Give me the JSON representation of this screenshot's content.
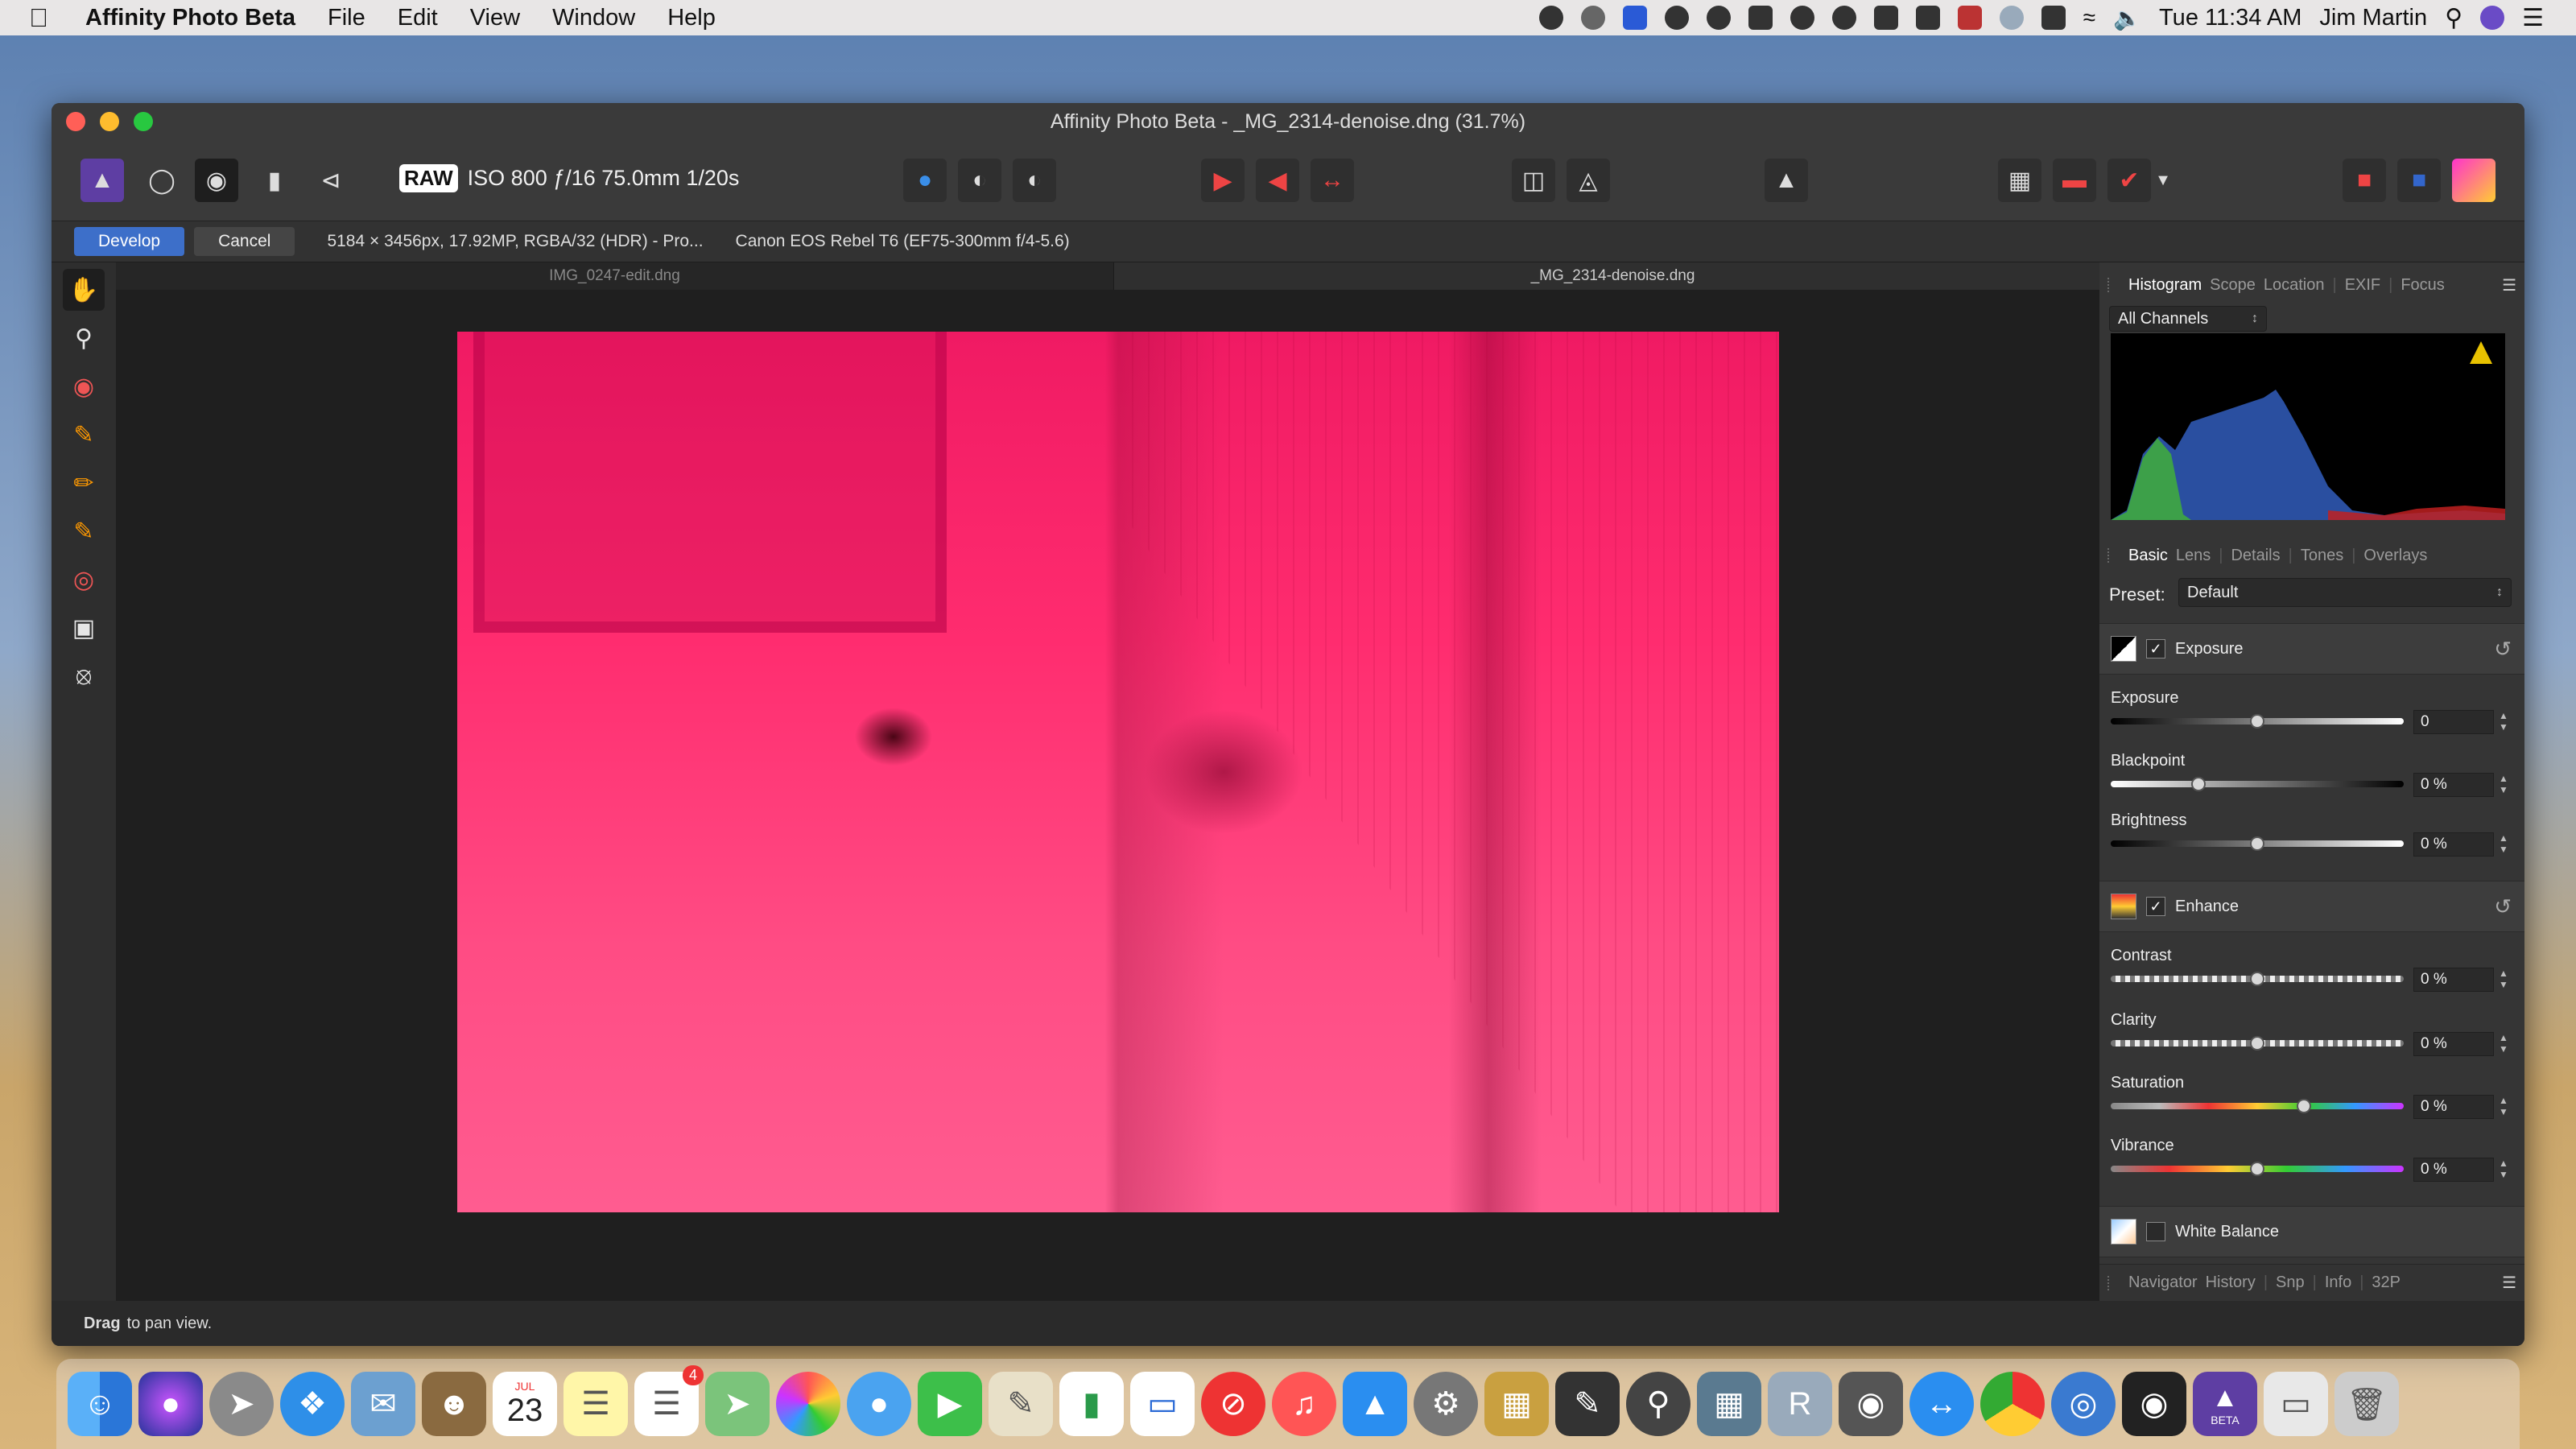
{
  "menubar": {
    "app_name": "Affinity Photo Beta",
    "menus": [
      "File",
      "Edit",
      "View",
      "Window",
      "Help"
    ],
    "clock": "Tue 11:34 AM",
    "user": "Jim Martin"
  },
  "window": {
    "title": "Affinity Photo Beta - _MG_2314-denoise.dng (31.7%)"
  },
  "toolbar": {
    "raw_badge": "RAW",
    "camera_info": "ISO 800 ƒ/16 75.0mm 1/20s"
  },
  "context": {
    "develop_label": "Develop",
    "cancel_label": "Cancel",
    "image_info": "5184 × 3456px, 17.92MP, RGBA/32 (HDR) - Pro...",
    "lens_info": "Canon EOS Rebel T6 (EF75-300mm f/4-5.6)"
  },
  "documents": {
    "tabs": [
      {
        "label": "IMG_0247-edit.dng"
      },
      {
        "label": "_MG_2314-denoise.dng"
      }
    ]
  },
  "status": {
    "bold": "Drag",
    "text": "to pan view."
  },
  "panel": {
    "top_tabs": [
      "Histogram",
      "Scope",
      "Location",
      "EXIF",
      "Focus"
    ],
    "channels": "All Channels",
    "basic_tabs": [
      "Basic",
      "Lens",
      "Details",
      "Tones",
      "Overlays"
    ],
    "preset_label": "Preset:",
    "preset_value": "Default",
    "exposure_section": "Exposure",
    "enhance_section": "Enhance",
    "white_balance_section": "White Balance",
    "sliders": [
      {
        "label": "Exposure",
        "value": "0",
        "position": 0.5
      },
      {
        "label": "Blackpoint",
        "value": "0 %",
        "position": 0.3
      },
      {
        "label": "Brightness",
        "value": "0 %",
        "position": 0.5
      },
      {
        "label": "Contrast",
        "value": "0 %",
        "position": 0.5
      },
      {
        "label": "Clarity",
        "value": "0 %",
        "position": 0.5
      },
      {
        "label": "Saturation",
        "value": "0 %",
        "position": 0.66
      },
      {
        "label": "Vibrance",
        "value": "0 %",
        "position": 0.5
      }
    ],
    "bottom_tabs": [
      "Navigator",
      "History",
      "Snp",
      "Info",
      "32P"
    ]
  },
  "dock": {
    "calendar_month": "JUL",
    "calendar_day": "23",
    "reminders_badge": "4",
    "beta_label": "BETA"
  }
}
